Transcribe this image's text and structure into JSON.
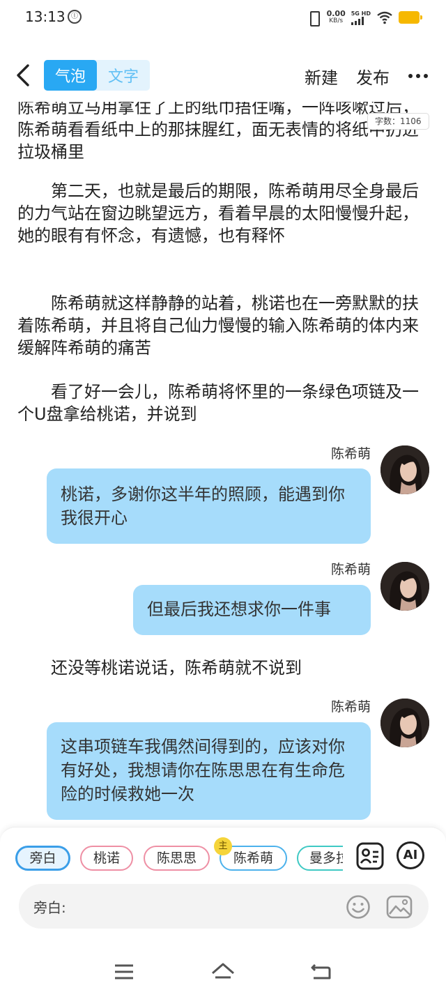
{
  "status_bar": {
    "time": "13:13",
    "badge": "ⓛ",
    "net_speed_value": "0.00",
    "net_speed_unit": "KB/s",
    "signal_label": "5G HD"
  },
  "top_bar": {
    "mode_bubble": "气泡",
    "mode_text": "文字",
    "new_label": "新建",
    "publish_label": "发布"
  },
  "word_count": "字数：1106",
  "story": {
    "para_cut": "陈希萌立马用拿住了上的纸巾捂住嘴，一阵咳嗽过后，陈希萌看看纸中上的那抹腥红，面无表情的将纸中扔进拉圾桶里",
    "para1": "第二天，也就是最后的期限，陈希萌用尽全身最后的力气站在窗边眺望远方，看着早晨的太阳慢慢升起，她的眼有有怀念，有遗憾，也有释怀",
    "para2": "陈希萌就这样静静的站着，桃诺也在一旁默默的扶着陈希萌，并且将自己仙力慢慢的输入陈希萌的体内来缓解阵希萌的痛苦",
    "para3": "看了好一会儿，陈希萌将怀里的一条绿色项链及一个U盘拿给桃诺，并说到",
    "msg1_sender": "陈希萌",
    "msg1_text": "桃诺，多谢你这半年的照顾，能遇到你我很开心",
    "msg2_sender": "陈希萌",
    "msg2_text": "但最后我还想求你一件事",
    "para4": "还没等桃诺说话，陈希萌就不说到",
    "msg3_sender": "陈希萌",
    "msg3_text": "这串项链车我偶然间得到的，应该对你有好处，我想请你在陈思思在有生命危险的时候救她一次"
  },
  "roles": {
    "narrator": "旁白",
    "taonuo": "桃诺",
    "chensisi": "陈思思",
    "chenximeng": "陈希萌",
    "manduo": "曼多拉",
    "main_badge": "主"
  },
  "input": {
    "label": "旁白:",
    "ai_label": "AI"
  }
}
